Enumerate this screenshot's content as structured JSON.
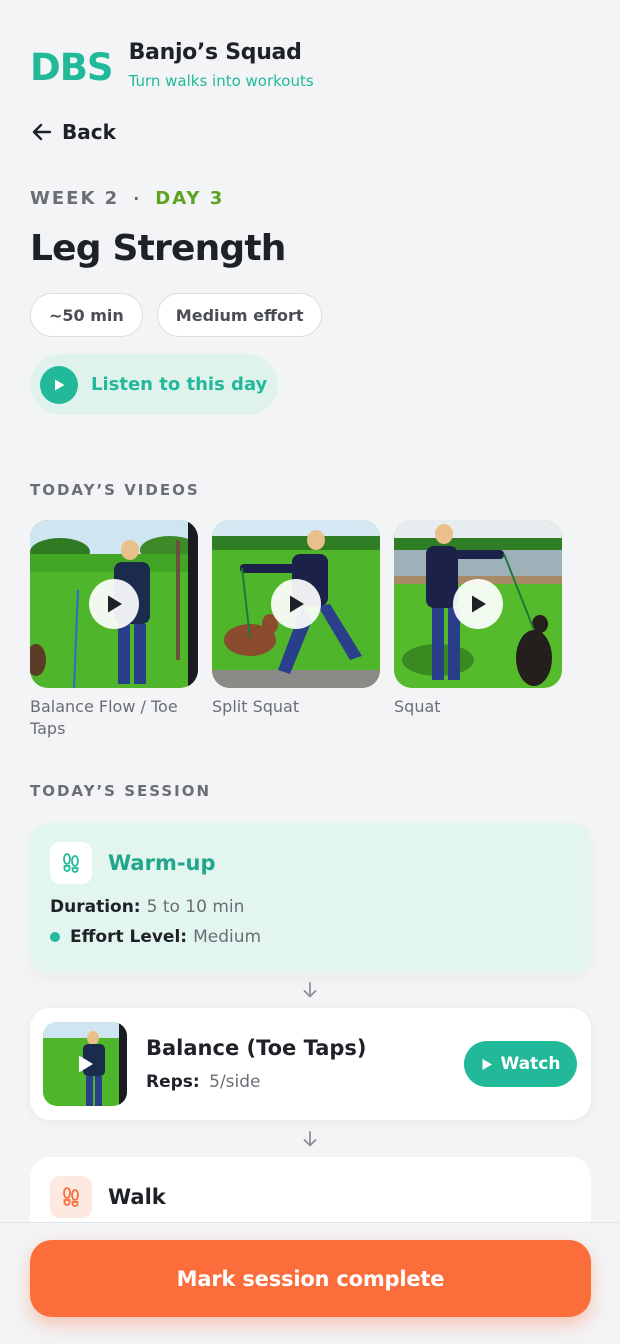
{
  "brand": {
    "logo": "DBS",
    "name": "Banjo’s Squad",
    "tagline": "Turn walks into workouts",
    "accent": "#22b99a"
  },
  "nav": {
    "back_label": "Back"
  },
  "plan": {
    "week": "WEEK 2",
    "separator": "·",
    "day": "DAY 3",
    "title": "Leg Strength",
    "chips": [
      "~50 min",
      "Medium effort"
    ],
    "listen_label": "Listen to this day"
  },
  "videos": {
    "heading": "TODAY’S VIDEOS",
    "items": [
      {
        "label": "Balance Flow / Toe Taps"
      },
      {
        "label": "Split Squat"
      },
      {
        "label": "Squat"
      }
    ]
  },
  "session": {
    "heading": "TODAY’S SESSION",
    "warmup": {
      "title": "Warm-up",
      "duration_label": "Duration:",
      "duration_value": "5 to 10 min",
      "effort_label": "Effort Level:",
      "effort_value": "Medium"
    },
    "exercise": {
      "title": "Balance (Toe Taps)",
      "reps_label": "Reps:",
      "reps_value": "5/side",
      "watch_label": "Watch"
    },
    "walk": {
      "title": "Walk"
    }
  },
  "cta": {
    "label": "Mark session complete",
    "color": "#fb6d3a"
  }
}
